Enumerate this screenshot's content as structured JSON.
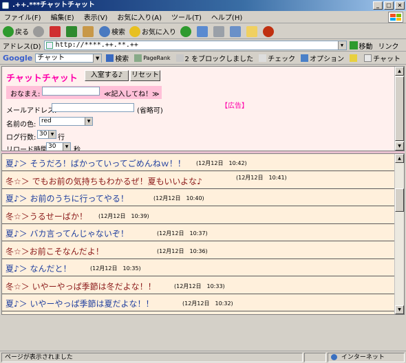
{
  "window": {
    "title": ".++.***チャットチャット",
    "buttons": [
      "_",
      "□",
      "×"
    ]
  },
  "menu": {
    "items": [
      "ファイル(F)",
      "編集(E)",
      "表示(V)",
      "お気に入り(A)",
      "ツール(T)",
      "ヘルプ(H)"
    ]
  },
  "toolbar": {
    "back": "戻る",
    "search": "検索",
    "favorites": "お気に入り"
  },
  "address": {
    "label": "アドレス(D)",
    "url": "http://****.++.**.++",
    "go": "移動",
    "links": "リンク"
  },
  "google": {
    "label": "Google",
    "field": "チャット",
    "search": "検索",
    "pagerank": "PageRank",
    "blocked": "2 をブロックしました",
    "check": "チェック",
    "options": "オプション",
    "chat": "チャット"
  },
  "form": {
    "title": "チャットチャット",
    "enter_button": "入室する♪",
    "reset_button": "リセット",
    "name_label": "おなまえ:",
    "name_hint": "≪記入してね！≫",
    "email_label": "メールアドレス:",
    "email_hint": "(省略可)",
    "color_label": "名前の色:",
    "color_value": "red",
    "lines_label": "ログ行数:",
    "lines_value": "30",
    "lines_unit": "行",
    "reload_label": "リロード時間:",
    "reload_value": "30",
    "reload_unit": "秒",
    "ad": "【広告】"
  },
  "colors": {
    "summer": "#1f3f9f",
    "winter": "#8b1a1a",
    "title_pink": "#ff00aa"
  },
  "messages": [
    {
      "text": "夏♪＞ そうだろ！ばかっていってごめんねｗ！！",
      "time": "(12月12日　10:42)",
      "who": "summer"
    },
    {
      "text": "冬☆＞ でもお前の気持ちもわかるぜ！夏もいいよな♪",
      "time": "(12月12日　10:41)",
      "who": "winter"
    },
    {
      "text": "夏♪＞ お前のうちに行ってやる！",
      "time": "(12月12日　10:40)",
      "who": "summer"
    },
    {
      "text": "冬☆＞うるせーばか！",
      "time": "(12月12日　10:39)",
      "who": "winter"
    },
    {
      "text": "夏♪＞ バカ言ってんじゃないぞ！",
      "time": "(12月12日　10:37)",
      "who": "summer"
    },
    {
      "text": "冬☆＞お前こそなんだよ！",
      "time": "(12月12日　10:36)",
      "who": "winter"
    },
    {
      "text": "夏♪＞ なんだと！",
      "time": "(12月12日　10:35)",
      "who": "summer"
    },
    {
      "text": "冬☆＞ いやーやっぱ季節は冬だよな！！",
      "time": "(12月12日　10:33)",
      "who": "winter"
    },
    {
      "text": "夏♪＞ いやーやっぱ季節は夏だよな！！",
      "time": "(12月12日　10:32)",
      "who": "summer"
    }
  ],
  "status": {
    "text": "ページが表示されました",
    "zone": "インターネット"
  }
}
